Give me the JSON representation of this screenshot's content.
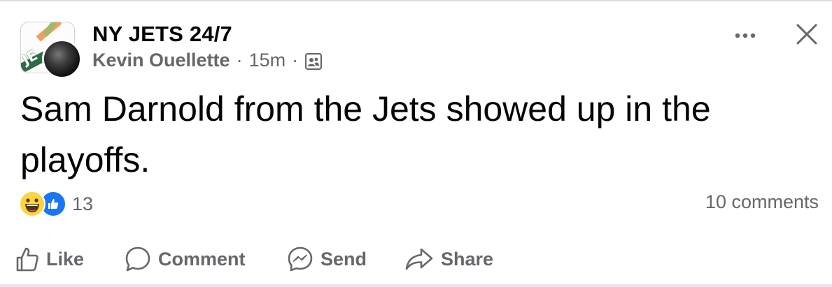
{
  "post": {
    "group_name": "NY JETS 24/7",
    "avatar_text": "JE",
    "author": "Kevin Ouellette",
    "separator": "·",
    "time_ago": "15m",
    "text": "Sam Darnold from the Jets showed up in the playoffs.",
    "reaction_count": "13",
    "comments_label": "10 comments",
    "reactions": [
      "haha",
      "like"
    ]
  },
  "actions": {
    "like": "Like",
    "comment": "Comment",
    "send": "Send",
    "share": "Share"
  },
  "icons": {
    "more": "more-horizontal-icon",
    "close": "close-icon",
    "audience": "group-members-icon"
  },
  "colors": {
    "text": "#050505",
    "secondary": "#65676b",
    "like_blue": "#1877f2",
    "haha_yellow": "#ffd33d"
  }
}
